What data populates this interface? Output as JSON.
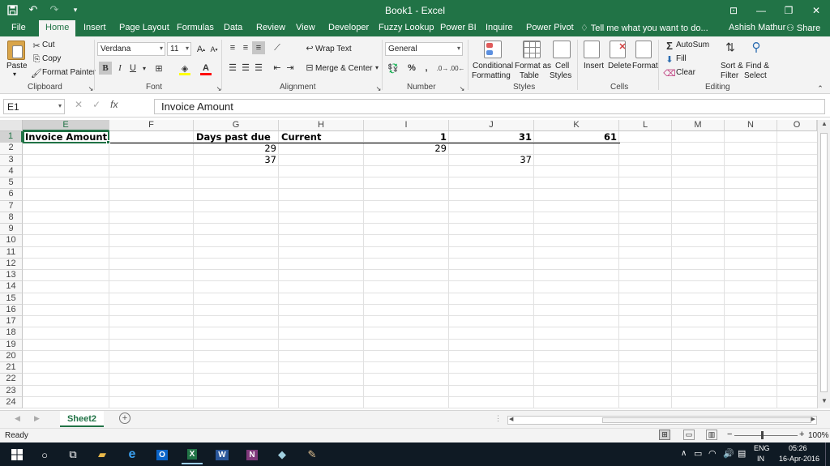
{
  "window": {
    "title": "Book1 - Excel",
    "qat": {
      "save_icon": "save-icon",
      "undo_icon": "undo-icon",
      "redo_icon": "redo-icon"
    },
    "controls": [
      "restore-ribbon-icon",
      "minimize-icon",
      "maximize-icon",
      "close-icon"
    ]
  },
  "tabs": [
    "File",
    "Home",
    "Insert",
    "Page Layout",
    "Formulas",
    "Data",
    "Review",
    "View",
    "Developer",
    "Fuzzy Lookup",
    "Power BI",
    "Inquire",
    "Power Pivot"
  ],
  "tell_me": "Tell me what you want to do...",
  "user": "Ashish Mathur",
  "share": "Share",
  "ribbon": {
    "clipboard": {
      "paste": "Paste",
      "cut": "Cut",
      "copy": "Copy",
      "format_painter": "Format Painter",
      "label": "Clipboard"
    },
    "font": {
      "name": "Verdana",
      "size": "11",
      "bold": "B",
      "italic": "I",
      "underline": "U",
      "label": "Font"
    },
    "alignment": {
      "wrap": "Wrap Text",
      "merge": "Merge & Center",
      "label": "Alignment"
    },
    "number": {
      "format": "General",
      "label": "Number"
    },
    "styles": {
      "conditional": "Conditional",
      "conditional2": "Formatting",
      "format_as": "Format as",
      "format_as2": "Table",
      "cell": "Cell",
      "cell2": "Styles",
      "label": "Styles"
    },
    "cells": {
      "insert": "Insert",
      "delete": "Delete",
      "format": "Format",
      "label": "Cells"
    },
    "editing": {
      "autosum": "AutoSum",
      "fill": "Fill",
      "clear": "Clear",
      "sort": "Sort &",
      "sort2": "Filter",
      "find": "Find &",
      "find2": "Select",
      "label": "Editing"
    }
  },
  "formula_bar": {
    "name_box": "E1",
    "fx": "fx",
    "content": "Invoice Amount"
  },
  "columns": [
    "E",
    "F",
    "G",
    "H",
    "I",
    "J",
    "K",
    "L",
    "M",
    "N",
    "O"
  ],
  "rows": [
    "1",
    "2",
    "3",
    "4",
    "5",
    "6",
    "7",
    "8",
    "9",
    "10",
    "11",
    "12",
    "13",
    "14",
    "15",
    "16",
    "17",
    "18",
    "19",
    "20",
    "21",
    "22",
    "23",
    "24"
  ],
  "cells": {
    "E1": "Invoice Amount",
    "G1": "Days past due",
    "H1": "Current",
    "I1": "1",
    "J1": "31",
    "K1": "61",
    "G2": "29",
    "I2": "29",
    "G3": "37",
    "J3": "37"
  },
  "sheet": {
    "name": "Sheet2"
  },
  "status": {
    "ready": "Ready",
    "zoom": "100%"
  },
  "taskbar": {
    "lang1": "ENG",
    "lang2": "IN",
    "time": "05:26",
    "date": "16-Apr-2016"
  }
}
